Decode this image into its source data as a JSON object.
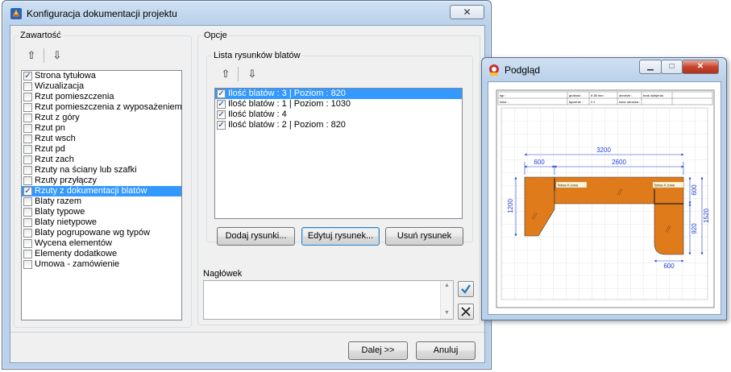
{
  "main_window": {
    "title": "Konfiguracja dokumentacji projektu",
    "close_symbol": "✕"
  },
  "content_group": {
    "label": "Zawartość",
    "up_arrow": "⇧",
    "down_arrow": "⇩",
    "items": [
      {
        "label": "Strona tytułowa",
        "checked": true,
        "selected": false
      },
      {
        "label": "Wizualizacja",
        "checked": false,
        "selected": false
      },
      {
        "label": "Rzut pomieszczenia",
        "checked": false,
        "selected": false
      },
      {
        "label": "Rzut pomieszczenia z wyposażeniem",
        "checked": false,
        "selected": false
      },
      {
        "label": "Rzut z góry",
        "checked": false,
        "selected": false
      },
      {
        "label": "Rzut pn",
        "checked": false,
        "selected": false
      },
      {
        "label": "Rzut wsch",
        "checked": false,
        "selected": false
      },
      {
        "label": "Rzut pd",
        "checked": false,
        "selected": false
      },
      {
        "label": "Rzut zach",
        "checked": false,
        "selected": false
      },
      {
        "label": "Rzuty na ściany lub szafki",
        "checked": false,
        "selected": false
      },
      {
        "label": "Rzuty przyłączy",
        "checked": false,
        "selected": false
      },
      {
        "label": "Rzuty z dokumentacji blatów",
        "checked": true,
        "selected": true
      },
      {
        "label": "Blaty razem",
        "checked": false,
        "selected": false
      },
      {
        "label": "Blaty typowe",
        "checked": false,
        "selected": false
      },
      {
        "label": "Blaty nietypowe",
        "checked": false,
        "selected": false
      },
      {
        "label": "Blaty pogrupowane wg typów",
        "checked": false,
        "selected": false
      },
      {
        "label": "Wycena elementów",
        "checked": false,
        "selected": false
      },
      {
        "label": "Elementy dodatkowe",
        "checked": false,
        "selected": false
      },
      {
        "label": "Umowa - zamówienie",
        "checked": false,
        "selected": false
      }
    ]
  },
  "options_group": {
    "label": "Opcje",
    "drawings_group": {
      "label": "Lista rysunków blatów",
      "up_arrow": "⇧",
      "down_arrow": "⇩",
      "items": [
        {
          "label": "Ilość blatów : 3  |  Poziom : 820",
          "checked": true,
          "selected": true
        },
        {
          "label": "Ilość blatów : 1  |  Poziom : 1030",
          "checked": true,
          "selected": false
        },
        {
          "label": "Ilość blatów : 4",
          "checked": true,
          "selected": false
        },
        {
          "label": "Ilość blatów : 2  |  Poziom : 820",
          "checked": true,
          "selected": false
        }
      ],
      "add_button": "Dodaj rysunki...",
      "edit_button": "Edytuj rysunek...",
      "remove_button": "Usuń rysunek"
    }
  },
  "header_group": {
    "label": "Nagłówek",
    "value": "",
    "confirm_icon": "checkmark-icon",
    "clear_icon": "x-icon"
  },
  "footer": {
    "next_button": "Dalej >>",
    "cancel_button": "Anuluj"
  },
  "preview_window": {
    "title": "Podgląd",
    "min_symbol": "▁",
    "max_symbol": "□",
    "close_symbol": "✕",
    "header_table": {
      "typ_label": "typ :",
      "kolor_label": "kolor :",
      "grubosc_label": "grubość :",
      "grubosc_value": "# 38 mm",
      "laczenie_label": "łączenie :",
      "laczenie_value": "2 x",
      "obrzeze_label": "obrzeże :",
      "obrzeze_value": "brak oklejenia",
      "kolor_obrzeza_label": "kolor obrzeża :"
    },
    "drawing": {
      "dim_total_width": "3200",
      "dim_left_width": "600",
      "dim_middle_width": "2600",
      "dim_left_depth": "1200",
      "dim_right_top_depth": "600",
      "dim_right_depth": "920",
      "dim_total_depth": "1520",
      "dim_bottom_width": "600",
      "strip_label_left": "listwa K.towa",
      "strip_label_right": "listwa K.towa",
      "worktop_color": "#e07b1c",
      "dim_color": "#1f3fd6"
    }
  }
}
